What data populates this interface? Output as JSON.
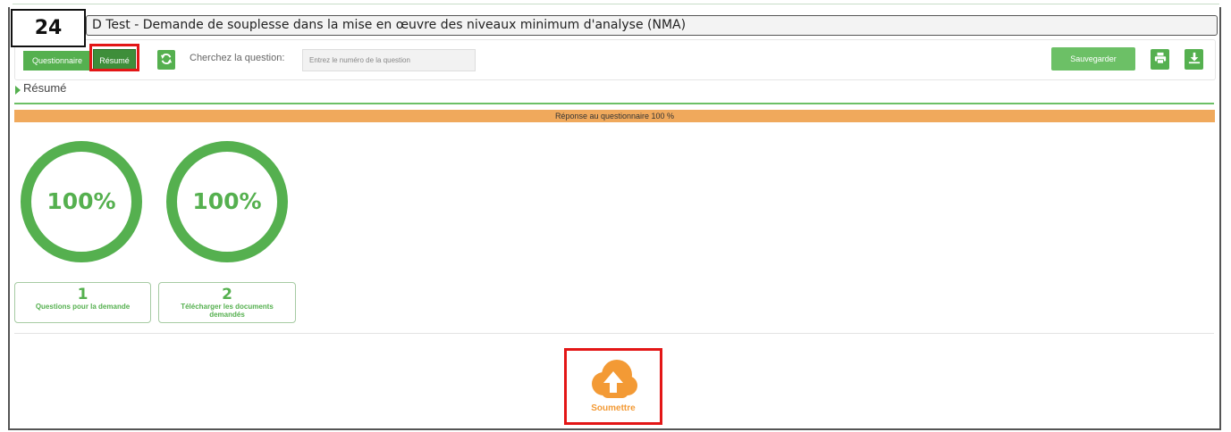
{
  "page_number": "24",
  "window": {
    "title": "D Test - Demande de souplesse dans la mise en œuvre des niveaux minimum d'analyse (NMA)"
  },
  "toolbar": {
    "questionnaire_label": "Questionnaire",
    "resume_label": "Résumé",
    "search_label": "Cherchez la question:",
    "search_placeholder": "Entrez le numéro de la question",
    "save_label": "Sauvegarder"
  },
  "summary": {
    "heading": "Résumé",
    "progress_text": "Réponse au questionnaire 100 %",
    "progress_value": 100
  },
  "gauges": [
    {
      "value": "100%"
    },
    {
      "value": "100%"
    }
  ],
  "cards": [
    {
      "number": "1",
      "label": "Questions pour la demande"
    },
    {
      "number": "2",
      "label": "Télécharger les documents demandés"
    }
  ],
  "submit": {
    "label": "Soumettre"
  },
  "colors": {
    "accent_green": "#55b04f",
    "progress_orange": "#f0a95c",
    "submit_orange": "#f39a35",
    "highlight_red": "#e31616"
  }
}
